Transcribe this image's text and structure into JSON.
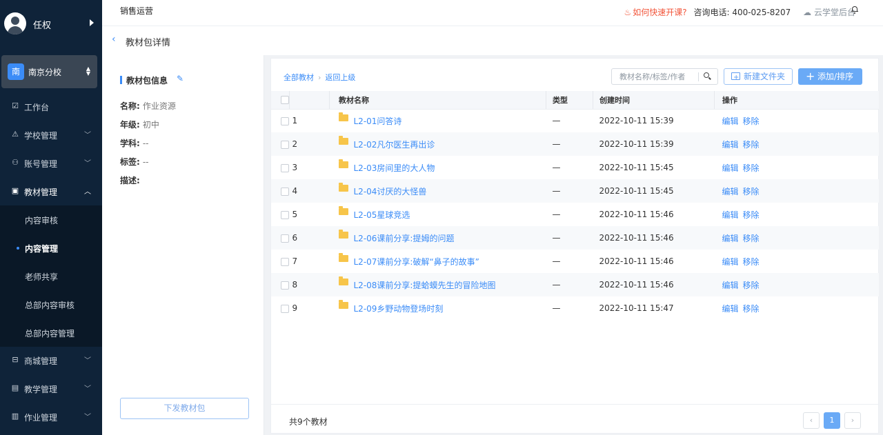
{
  "user": {
    "name": "任权"
  },
  "branch": {
    "badge": "南",
    "name": "南京分校"
  },
  "menu": [
    {
      "label": "工作台",
      "icon": "workbench-icon",
      "glyph": "☑"
    },
    {
      "label": "学校管理",
      "icon": "school-icon",
      "glyph": "⚠"
    },
    {
      "label": "账号管理",
      "icon": "account-icon",
      "glyph": "⚇"
    },
    {
      "label": "教材管理",
      "icon": "textbook-icon",
      "glyph": "▣"
    },
    {
      "label": "商城管理",
      "icon": "mall-icon",
      "glyph": "⊟"
    },
    {
      "label": "教学管理",
      "icon": "teaching-icon",
      "glyph": "▤"
    },
    {
      "label": "作业管理",
      "icon": "homework-icon",
      "glyph": "▥"
    }
  ],
  "submenu": [
    "内容审核",
    "内容管理",
    "老师共享",
    "总部内容审核",
    "总部内容管理"
  ],
  "topbar": {
    "title": "销售运营",
    "hot_link": "如何快速开课?",
    "phone_label": "咨询电话:",
    "phone": "400-025-8207",
    "backend": "云学堂后台"
  },
  "page": {
    "title": "教材包详情"
  },
  "info": {
    "heading": "教材包信息",
    "rows": [
      {
        "key": "名称:",
        "value": "作业资源"
      },
      {
        "key": "年级:",
        "value": "初中"
      },
      {
        "key": "学科:",
        "value": "--"
      },
      {
        "key": "标签:",
        "value": "--"
      },
      {
        "key": "描述:",
        "value": ""
      }
    ],
    "dispatch_button": "下发教材包"
  },
  "toolbar": {
    "crumb_all": "全部教材",
    "crumb_up": "返回上级",
    "search_placeholder": "教材名称/标签/作者",
    "new_folder": "新建文件夹",
    "add_sort": "添加/排序"
  },
  "table": {
    "headers": [
      "教材名称",
      "类型",
      "创建时间",
      "操作"
    ],
    "rows": [
      {
        "no": "1",
        "name": "L2-01问答诗",
        "type": "—",
        "time": "2022-10-11 15:39"
      },
      {
        "no": "2",
        "name": "L2-02凡尔医生再出诊",
        "type": "—",
        "time": "2022-10-11 15:39"
      },
      {
        "no": "3",
        "name": "L2-03房间里的大人物",
        "type": "—",
        "time": "2022-10-11 15:45"
      },
      {
        "no": "4",
        "name": "L2-04讨厌的大怪兽",
        "type": "—",
        "time": "2022-10-11 15:45"
      },
      {
        "no": "5",
        "name": "L2-05星球竞选",
        "type": "—",
        "time": "2022-10-11 15:46"
      },
      {
        "no": "6",
        "name": "L2-06课前分享:提姆的问题",
        "type": "—",
        "time": "2022-10-11 15:46"
      },
      {
        "no": "7",
        "name": "L2-07课前分享:破解“鼻子的故事”",
        "type": "—",
        "time": "2022-10-11 15:46"
      },
      {
        "no": "8",
        "name": "L2-08课前分享:提蛤蟆先生的冒险地图",
        "type": "—",
        "time": "2022-10-11 15:46"
      },
      {
        "no": "9",
        "name": "L2-09乡野动物登场时刻",
        "type": "—",
        "time": "2022-10-11 15:47"
      }
    ],
    "op_edit": "编辑",
    "op_remove": "移除"
  },
  "footer": {
    "total": "共9个教材",
    "current_page": "1"
  }
}
